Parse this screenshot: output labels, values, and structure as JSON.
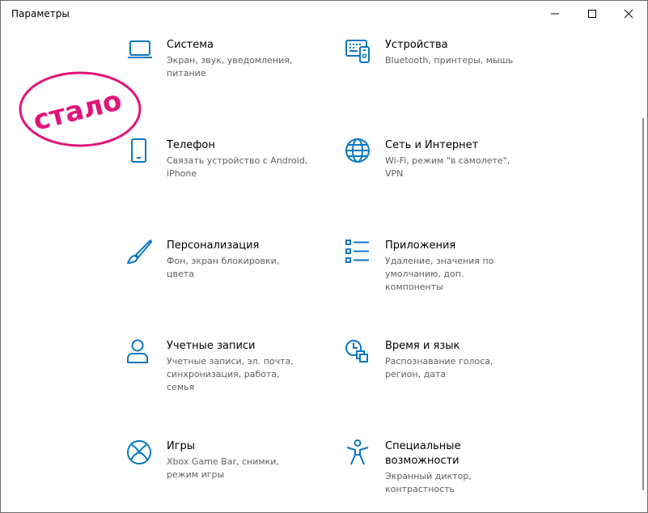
{
  "window": {
    "title": "Параметры"
  },
  "controls": {
    "minimize_icon": "minimize-icon",
    "maximize_icon": "maximize-icon",
    "close_icon": "close-icon"
  },
  "accent_color": "#0a77c0",
  "stamp": {
    "text": "стало",
    "color": "#e0157a"
  },
  "categories": [
    {
      "title": "Система",
      "description": "Экран, звук, уведомления, питание",
      "icon": "laptop-icon"
    },
    {
      "title": "Устройства",
      "description": "Bluetooth, принтеры, мышь",
      "icon": "keyboard-devices-icon"
    },
    {
      "title": "Телефон",
      "description": "Связать устройство с Android, iPhone",
      "icon": "phone-icon"
    },
    {
      "title": "Сеть и Интернет",
      "description": "Wi-Fi, режим \"в самолете\", VPN",
      "icon": "globe-icon"
    },
    {
      "title": "Персонализация",
      "description": "Фон, экран блокировки, цвета",
      "icon": "paintbrush-icon"
    },
    {
      "title": "Приложения",
      "description": "Удаление, значения по умолчанию, доп. компоненты",
      "icon": "apps-list-icon"
    },
    {
      "title": "Учетные записи",
      "description": "Учетные записи, эл. почта, синхронизация, работа, семья",
      "icon": "user-icon"
    },
    {
      "title": "Время и язык",
      "description": "Распознавание голоса, регион, дата",
      "icon": "time-language-icon"
    },
    {
      "title": "Игры",
      "description": "Xbox Game Bar, снимки, режим игры",
      "icon": "xbox-icon"
    },
    {
      "title": "Специальные возможности",
      "description": "Экранный диктор, контрастность",
      "icon": "accessibility-icon"
    }
  ]
}
